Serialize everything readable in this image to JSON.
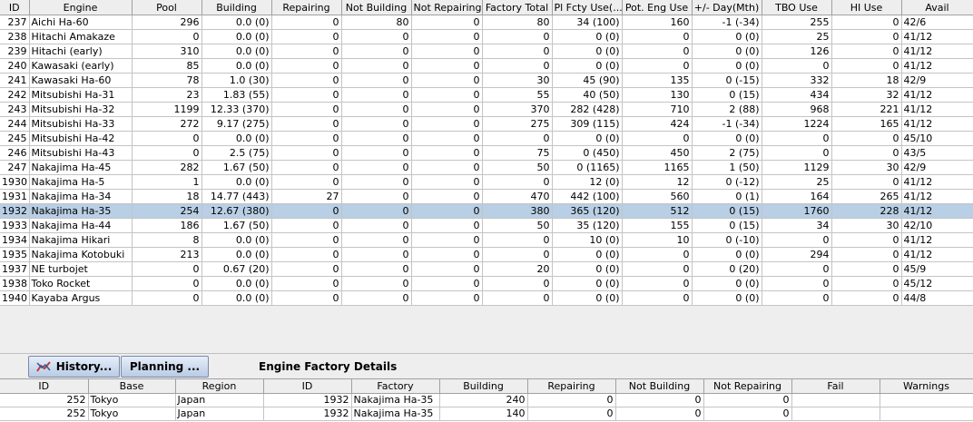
{
  "engine_table": {
    "columns": [
      "ID",
      "Engine",
      "Pool",
      "Building",
      "Repairing",
      "Not Building",
      "Not Repairing",
      "Factory Total",
      "Pl Fcty Use(...",
      "Pot. Eng Use",
      "+/- Day(Mth)",
      "TBO Use",
      "HI Use",
      "Avail"
    ],
    "rows": [
      [
        "237",
        "Aichi Ha-60",
        "296",
        "0.0 (0)",
        "0",
        "80",
        "0",
        "80",
        "34 (100)",
        "160",
        "-1 (-34)",
        "255",
        "0",
        "42/6"
      ],
      [
        "238",
        "Hitachi Amakaze",
        "0",
        "0.0 (0)",
        "0",
        "0",
        "0",
        "0",
        "0 (0)",
        "0",
        "0 (0)",
        "25",
        "0",
        "41/12"
      ],
      [
        "239",
        "Hitachi (early)",
        "310",
        "0.0 (0)",
        "0",
        "0",
        "0",
        "0",
        "0 (0)",
        "0",
        "0 (0)",
        "126",
        "0",
        "41/12"
      ],
      [
        "240",
        "Kawasaki (early)",
        "85",
        "0.0 (0)",
        "0",
        "0",
        "0",
        "0",
        "0 (0)",
        "0",
        "0 (0)",
        "0",
        "0",
        "41/12"
      ],
      [
        "241",
        "Kawasaki Ha-60",
        "78",
        "1.0 (30)",
        "0",
        "0",
        "0",
        "30",
        "45 (90)",
        "135",
        "0 (-15)",
        "332",
        "18",
        "42/9"
      ],
      [
        "242",
        "Mitsubishi Ha-31",
        "23",
        "1.83 (55)",
        "0",
        "0",
        "0",
        "55",
        "40 (50)",
        "130",
        "0 (15)",
        "434",
        "32",
        "41/12"
      ],
      [
        "243",
        "Mitsubishi Ha-32",
        "1199",
        "12.33 (370)",
        "0",
        "0",
        "0",
        "370",
        "282 (428)",
        "710",
        "2 (88)",
        "968",
        "221",
        "41/12"
      ],
      [
        "244",
        "Mitsubishi Ha-33",
        "272",
        "9.17 (275)",
        "0",
        "0",
        "0",
        "275",
        "309 (115)",
        "424",
        "-1 (-34)",
        "1224",
        "165",
        "41/12"
      ],
      [
        "245",
        "Mitsubishi Ha-42",
        "0",
        "0.0 (0)",
        "0",
        "0",
        "0",
        "0",
        "0 (0)",
        "0",
        "0 (0)",
        "0",
        "0",
        "45/10"
      ],
      [
        "246",
        "Mitsubishi Ha-43",
        "0",
        "2.5 (75)",
        "0",
        "0",
        "0",
        "75",
        "0 (450)",
        "450",
        "2 (75)",
        "0",
        "0",
        "43/5"
      ],
      [
        "247",
        "Nakajima Ha-45",
        "282",
        "1.67 (50)",
        "0",
        "0",
        "0",
        "50",
        "0 (1165)",
        "1165",
        "1 (50)",
        "1129",
        "30",
        "42/9"
      ],
      [
        "1930",
        "Nakajima Ha-5",
        "1",
        "0.0 (0)",
        "0",
        "0",
        "0",
        "0",
        "12 (0)",
        "12",
        "0 (-12)",
        "25",
        "0",
        "41/12"
      ],
      [
        "1931",
        "Nakajima Ha-34",
        "18",
        "14.77 (443)",
        "27",
        "0",
        "0",
        "470",
        "442 (100)",
        "560",
        "0 (1)",
        "164",
        "265",
        "41/12"
      ],
      [
        "1932",
        "Nakajima Ha-35",
        "254",
        "12.67 (380)",
        "0",
        "0",
        "0",
        "380",
        "365 (120)",
        "512",
        "0 (15)",
        "1760",
        "228",
        "41/12"
      ],
      [
        "1933",
        "Nakajima Ha-44",
        "186",
        "1.67 (50)",
        "0",
        "0",
        "0",
        "50",
        "35 (120)",
        "155",
        "0 (15)",
        "34",
        "30",
        "42/10"
      ],
      [
        "1934",
        "Nakajima Hikari",
        "8",
        "0.0 (0)",
        "0",
        "0",
        "0",
        "0",
        "10 (0)",
        "10",
        "0 (-10)",
        "0",
        "0",
        "41/12"
      ],
      [
        "1935",
        "Nakajima Kotobuki",
        "213",
        "0.0 (0)",
        "0",
        "0",
        "0",
        "0",
        "0 (0)",
        "0",
        "0 (0)",
        "294",
        "0",
        "41/12"
      ],
      [
        "1937",
        "NE turbojet",
        "0",
        "0.67 (20)",
        "0",
        "0",
        "0",
        "20",
        "0 (0)",
        "0",
        "0 (20)",
        "0",
        "0",
        "45/9"
      ],
      [
        "1938",
        "Toko Rocket",
        "0",
        "0.0 (0)",
        "0",
        "0",
        "0",
        "0",
        "0 (0)",
        "0",
        "0 (0)",
        "0",
        "0",
        "45/12"
      ],
      [
        "1940",
        "Kayaba Argus",
        "0",
        "0.0 (0)",
        "0",
        "0",
        "0",
        "0",
        "0 (0)",
        "0",
        "0 (0)",
        "0",
        "0",
        "44/8"
      ]
    ],
    "selected_row_index": 13
  },
  "toolbar": {
    "history_label": "History...",
    "planning_label": "Planning ...",
    "details_title": "Engine Factory Details",
    "history_icon": "history-icon"
  },
  "factory_table": {
    "columns": [
      "ID",
      "Base",
      "Region",
      "ID",
      "Factory",
      "Building",
      "Repairing",
      "Not Building",
      "Not Repairing",
      "Fail",
      "Warnings"
    ],
    "rows": [
      [
        "252",
        "Tokyo",
        "Japan",
        "1932",
        "Nakajima Ha-35",
        "240",
        "0",
        "0",
        "0",
        "",
        ""
      ],
      [
        "252",
        "Tokyo",
        "Japan",
        "1932",
        "Nakajima Ha-35",
        "140",
        "0",
        "0",
        "0",
        "",
        ""
      ]
    ]
  },
  "colors": {
    "selection": "#b8cfe5",
    "header_bg": "#eeeeee",
    "button_gradient_top": "#e6eefa",
    "button_gradient_bottom": "#b9cbe4"
  }
}
